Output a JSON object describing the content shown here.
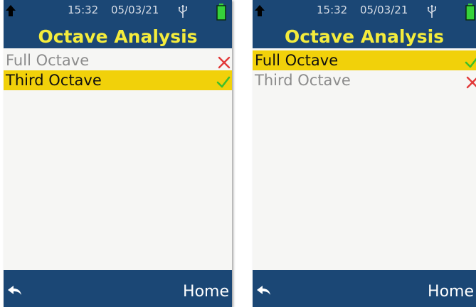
{
  "screens": [
    {
      "status": {
        "time": "15:32",
        "date": "05/03/21"
      },
      "title": "Octave Analysis",
      "options": [
        {
          "label": "Full Octave",
          "selected": false,
          "state_icon": "cross-icon"
        },
        {
          "label": "Third Octave",
          "selected": true,
          "state_icon": "check-icon"
        }
      ],
      "footer": {
        "home_label": "Home"
      }
    },
    {
      "status": {
        "time": "15:32",
        "date": "05/03/21"
      },
      "title": "Octave Analysis",
      "options": [
        {
          "label": "Full Octave",
          "selected": true,
          "state_icon": "check-icon"
        },
        {
          "label": "Third Octave",
          "selected": false,
          "state_icon": "cross-icon"
        }
      ],
      "footer": {
        "home_label": "Home"
      }
    }
  ],
  "colors": {
    "header_bg": "#1b4775",
    "title": "#f4ec3c",
    "highlight": "#f1d10a",
    "check": "#3fbf2a",
    "cross": "#e23a3a",
    "battery": "#36d23a"
  }
}
